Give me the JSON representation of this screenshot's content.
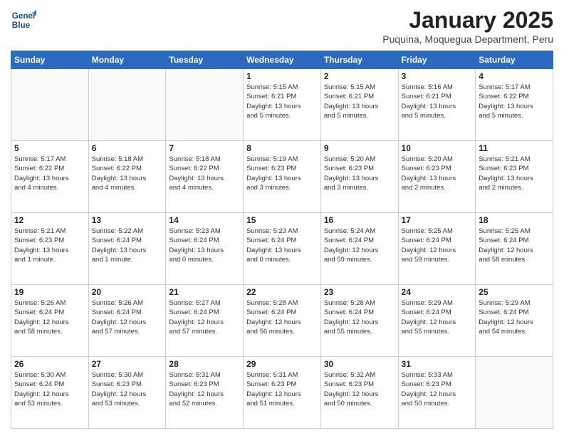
{
  "logo": {
    "line1": "General",
    "line2": "Blue"
  },
  "title": "January 2025",
  "subtitle": "Puquina, Moquegua Department, Peru",
  "weekdays": [
    "Sunday",
    "Monday",
    "Tuesday",
    "Wednesday",
    "Thursday",
    "Friday",
    "Saturday"
  ],
  "weeks": [
    [
      {
        "day": "",
        "info": ""
      },
      {
        "day": "",
        "info": ""
      },
      {
        "day": "",
        "info": ""
      },
      {
        "day": "1",
        "info": "Sunrise: 5:15 AM\nSunset: 6:21 PM\nDaylight: 13 hours\nand 5 minutes."
      },
      {
        "day": "2",
        "info": "Sunrise: 5:15 AM\nSunset: 6:21 PM\nDaylight: 13 hours\nand 5 minutes."
      },
      {
        "day": "3",
        "info": "Sunrise: 5:16 AM\nSunset: 6:21 PM\nDaylight: 13 hours\nand 5 minutes."
      },
      {
        "day": "4",
        "info": "Sunrise: 5:17 AM\nSunset: 6:22 PM\nDaylight: 13 hours\nand 5 minutes."
      }
    ],
    [
      {
        "day": "5",
        "info": "Sunrise: 5:17 AM\nSunset: 6:22 PM\nDaylight: 13 hours\nand 4 minutes."
      },
      {
        "day": "6",
        "info": "Sunrise: 5:18 AM\nSunset: 6:22 PM\nDaylight: 13 hours\nand 4 minutes."
      },
      {
        "day": "7",
        "info": "Sunrise: 5:18 AM\nSunset: 6:22 PM\nDaylight: 13 hours\nand 4 minutes."
      },
      {
        "day": "8",
        "info": "Sunrise: 5:19 AM\nSunset: 6:23 PM\nDaylight: 13 hours\nand 3 minutes."
      },
      {
        "day": "9",
        "info": "Sunrise: 5:20 AM\nSunset: 6:23 PM\nDaylight: 13 hours\nand 3 minutes."
      },
      {
        "day": "10",
        "info": "Sunrise: 5:20 AM\nSunset: 6:23 PM\nDaylight: 13 hours\nand 2 minutes."
      },
      {
        "day": "11",
        "info": "Sunrise: 5:21 AM\nSunset: 6:23 PM\nDaylight: 13 hours\nand 2 minutes."
      }
    ],
    [
      {
        "day": "12",
        "info": "Sunrise: 5:21 AM\nSunset: 6:23 PM\nDaylight: 13 hours\nand 1 minute."
      },
      {
        "day": "13",
        "info": "Sunrise: 5:22 AM\nSunset: 6:24 PM\nDaylight: 13 hours\nand 1 minute."
      },
      {
        "day": "14",
        "info": "Sunrise: 5:23 AM\nSunset: 6:24 PM\nDaylight: 13 hours\nand 0 minutes."
      },
      {
        "day": "15",
        "info": "Sunrise: 5:23 AM\nSunset: 6:24 PM\nDaylight: 13 hours\nand 0 minutes."
      },
      {
        "day": "16",
        "info": "Sunrise: 5:24 AM\nSunset: 6:24 PM\nDaylight: 12 hours\nand 59 minutes."
      },
      {
        "day": "17",
        "info": "Sunrise: 5:25 AM\nSunset: 6:24 PM\nDaylight: 12 hours\nand 59 minutes."
      },
      {
        "day": "18",
        "info": "Sunrise: 5:25 AM\nSunset: 6:24 PM\nDaylight: 12 hours\nand 58 minutes."
      }
    ],
    [
      {
        "day": "19",
        "info": "Sunrise: 5:26 AM\nSunset: 6:24 PM\nDaylight: 12 hours\nand 58 minutes."
      },
      {
        "day": "20",
        "info": "Sunrise: 5:26 AM\nSunset: 6:24 PM\nDaylight: 12 hours\nand 57 minutes."
      },
      {
        "day": "21",
        "info": "Sunrise: 5:27 AM\nSunset: 6:24 PM\nDaylight: 12 hours\nand 57 minutes."
      },
      {
        "day": "22",
        "info": "Sunrise: 5:28 AM\nSunset: 6:24 PM\nDaylight: 12 hours\nand 56 minutes."
      },
      {
        "day": "23",
        "info": "Sunrise: 5:28 AM\nSunset: 6:24 PM\nDaylight: 12 hours\nand 55 minutes."
      },
      {
        "day": "24",
        "info": "Sunrise: 5:29 AM\nSunset: 6:24 PM\nDaylight: 12 hours\nand 55 minutes."
      },
      {
        "day": "25",
        "info": "Sunrise: 5:29 AM\nSunset: 6:24 PM\nDaylight: 12 hours\nand 54 minutes."
      }
    ],
    [
      {
        "day": "26",
        "info": "Sunrise: 5:30 AM\nSunset: 6:24 PM\nDaylight: 12 hours\nand 53 minutes."
      },
      {
        "day": "27",
        "info": "Sunrise: 5:30 AM\nSunset: 6:23 PM\nDaylight: 12 hours\nand 53 minutes."
      },
      {
        "day": "28",
        "info": "Sunrise: 5:31 AM\nSunset: 6:23 PM\nDaylight: 12 hours\nand 52 minutes."
      },
      {
        "day": "29",
        "info": "Sunrise: 5:31 AM\nSunset: 6:23 PM\nDaylight: 12 hours\nand 51 minutes."
      },
      {
        "day": "30",
        "info": "Sunrise: 5:32 AM\nSunset: 6:23 PM\nDaylight: 12 hours\nand 50 minutes."
      },
      {
        "day": "31",
        "info": "Sunrise: 5:33 AM\nSunset: 6:23 PM\nDaylight: 12 hours\nand 50 minutes."
      },
      {
        "day": "",
        "info": ""
      }
    ]
  ]
}
